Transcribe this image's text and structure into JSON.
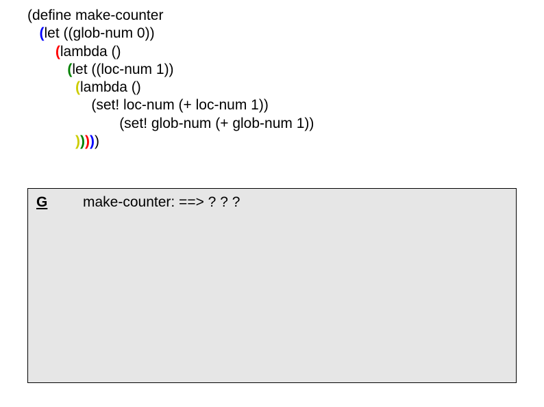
{
  "code": {
    "l1": "(define make-counter",
    "l2_pre": "   ",
    "l2_paren": "(",
    "l2_rest": "let ((glob-num 0))",
    "l3_pre": "       ",
    "l3_paren": "(",
    "l3_rest": "lambda ()",
    "l4_pre": "          ",
    "l4_paren": "(",
    "l4_rest": "let ((loc-num 1))",
    "l5_pre": "            ",
    "l5_paren": "(",
    "l5_rest": "lambda ()",
    "l6": "                (set! loc-num (+ loc-num 1))",
    "l7": "                       (set! glob-num (+ glob-num 1))",
    "l8_pre": "            ",
    "l8_p1": ")",
    "l8_p2": ")",
    "l8_p3": ")",
    "l8_p4": ")",
    "l8_p5": ")"
  },
  "env": {
    "label": "G",
    "value": "make-counter: ==> ? ? ?"
  }
}
